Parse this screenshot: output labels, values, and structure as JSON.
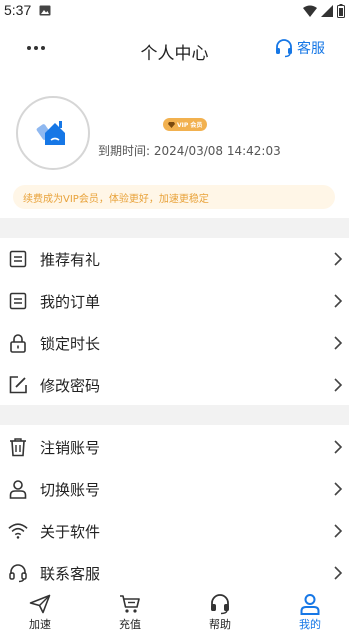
{
  "status_bar": {
    "time": "5:37"
  },
  "header": {
    "title": "个人中心",
    "service_label": "客服"
  },
  "profile": {
    "vip_badge": "VIP 会员",
    "expire_label": "到期时间:",
    "expire_value": "2024/03/08 14:42:03"
  },
  "notice": {
    "text": "续费成为VIP会员，体验更好，加速更稳定"
  },
  "menu": {
    "group1": [
      {
        "label": "推荐有礼",
        "icon": "list-icon"
      },
      {
        "label": "我的订单",
        "icon": "order-icon"
      },
      {
        "label": "锁定时长",
        "icon": "lock-icon"
      },
      {
        "label": "修改密码",
        "icon": "edit-icon"
      }
    ],
    "group2": [
      {
        "label": "注销账号",
        "icon": "trash-icon"
      },
      {
        "label": "切换账号",
        "icon": "user-icon"
      },
      {
        "label": "关于软件",
        "icon": "wifi-icon"
      },
      {
        "label": "联系客服",
        "icon": "headset-icon"
      }
    ]
  },
  "tabs": [
    {
      "label": "加速",
      "icon": "send-icon"
    },
    {
      "label": "充值",
      "icon": "cart-icon"
    },
    {
      "label": "帮助",
      "icon": "headset-icon"
    },
    {
      "label": "我的",
      "icon": "person-icon"
    }
  ],
  "colors": {
    "accent": "#1677e6",
    "vip": "#f2b14f",
    "notice_text": "#e8a23a",
    "notice_bg": "#fff6e7",
    "band": "#f2f2f2"
  }
}
